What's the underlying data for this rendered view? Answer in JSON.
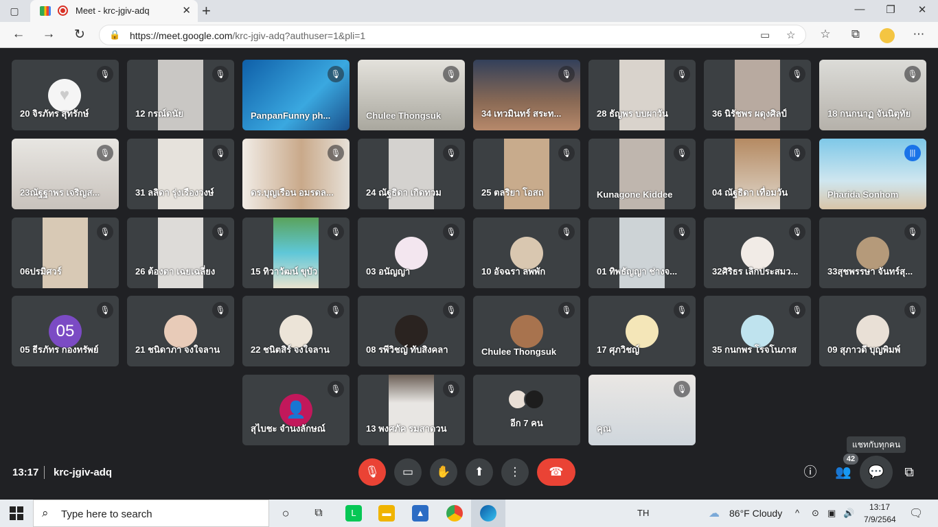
{
  "browser": {
    "tab_title": "Meet - krc-jgiv-adq",
    "close_glyph": "✕",
    "newtab_glyph": "+",
    "url_host": "https://meet.google.com",
    "url_path": "/krc-jgiv-adq?authuser=1&pli=1"
  },
  "tiles": [
    {
      "name": "20 จิรภัทร สุทรักษ์"
    },
    {
      "name": "12 กรณ์ดนัย"
    },
    {
      "name": "PanpanFunny ph..."
    },
    {
      "name": "Chulee Thongsuk"
    },
    {
      "name": "34 เทวมินทร์ สระท..."
    },
    {
      "name": "28 ธัญพร บบผาวัน"
    },
    {
      "name": "36 นิรัชพร ผดุงศิลป์"
    },
    {
      "name": "18 กนกนาฏ จันนิตุทัย"
    },
    {
      "name": "23ณัฐฐาพร เจริญส..."
    },
    {
      "name": "31 ลลิดา รุ่งเรืองวงษ์"
    },
    {
      "name": "ดร.บุญเรือน อมรดล..."
    },
    {
      "name": "24 ณัฐธิดา เกิดทวม"
    },
    {
      "name": "25 ตลริยา โอสถ"
    },
    {
      "name": "Kunagone Kiddee"
    },
    {
      "name": "04 ณัฐธิดา เทื่อมวัน"
    },
    {
      "name": "Pharida Sonhom"
    },
    {
      "name": "06ปรมิศวร์"
    },
    {
      "name": "26 ต้องตา เฉยเฉลี่ยง"
    },
    {
      "name": "15 ทิวาวัฒน์ ขุบัว"
    },
    {
      "name": "03 อนัญญา"
    },
    {
      "name": "10 อัจฉรา ลพพัก"
    },
    {
      "name": "01 ทิพธัญญา ช่างจ..."
    },
    {
      "name": "32ศิริธร เลิกประสมว..."
    },
    {
      "name": "33สุชพรรษา จันทร์สุ..."
    },
    {
      "name": "05 ธีรภัทร กองทรัพย์",
      "avatar_text": "05"
    },
    {
      "name": "21 ชนิดาภา จงใจลาน"
    },
    {
      "name": "22 ชนิตสิร์ จงใจลาน"
    },
    {
      "name": "08 รพีวิชญ์ ทับสิงคลา"
    },
    {
      "name": "Chulee Thongsuk"
    },
    {
      "name": "17 ศุภวิชญ์"
    },
    {
      "name": "35 กนกพร โรจโนภาส"
    },
    {
      "name": "09 สุภาวดี บุญพิมพ์"
    },
    {
      "name": "สุไบชะ จำนงลักษณ์"
    },
    {
      "name": "13 พงศภัค รมสาดวน"
    },
    {
      "name": "อีก 7 คน"
    },
    {
      "name": "คุณ"
    }
  ],
  "meeting": {
    "time": "13:17",
    "code": "krc-jgiv-adq",
    "participant_count": "42",
    "chat_tooltip": "แชทกับทุกคน"
  },
  "taskbar": {
    "search_placeholder": "Type here to search",
    "lang": "TH",
    "weather": "86°F  Cloudy",
    "time": "13:17",
    "date": "7/9/2564"
  }
}
